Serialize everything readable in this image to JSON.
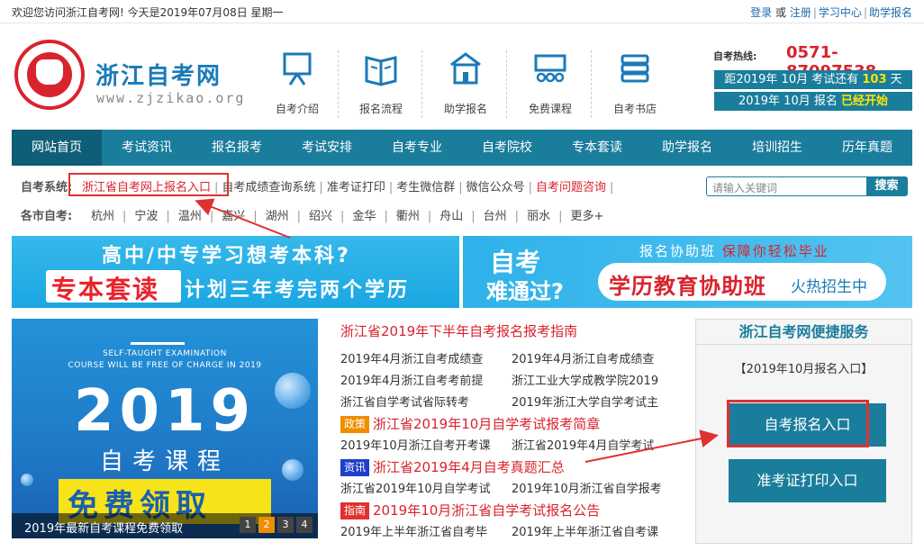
{
  "topbar": {
    "welcome": "欢迎您访问浙江自考网! 今天是2019年07月08日 星期一",
    "login": "登录",
    "or": "或",
    "register": "注册",
    "study_center": "学习中心",
    "assist_signup": "助学报名"
  },
  "header": {
    "site_name": "浙江自考网",
    "site_url": "www.zjzikao.org",
    "nav_icons": [
      {
        "label": "自考介绍",
        "icon": "presentation-board-icon"
      },
      {
        "label": "报名流程",
        "icon": "open-book-icon"
      },
      {
        "label": "助学报名",
        "icon": "school-building-icon"
      },
      {
        "label": "免费课程",
        "icon": "classroom-icon"
      },
      {
        "label": "自考书店",
        "icon": "book-stack-icon"
      }
    ],
    "hotline_label": "自考热线:",
    "hotline_number": "0571-87097538",
    "countdown_prefix": "距2019年 10月 考试还有",
    "countdown_days": "103",
    "countdown_suffix": "天",
    "signup_prefix": "2019年 10月 报名",
    "signup_status": "已经开始"
  },
  "main_nav": [
    "网站首页",
    "考试资讯",
    "报名报考",
    "考试安排",
    "自考专业",
    "自考院校",
    "专本套读",
    "助学报名",
    "培训招生",
    "历年真题"
  ],
  "system_row": {
    "label": "自考系统:",
    "links": [
      {
        "text": "浙江省自考网上报名入口",
        "red": true
      },
      {
        "text": "自考成绩查询系统",
        "red": false
      },
      {
        "text": "准考证打印",
        "red": false
      },
      {
        "text": "考生微信群",
        "red": false
      },
      {
        "text": "微信公众号",
        "red": false
      },
      {
        "text": "自考问题咨询",
        "red": true
      }
    ]
  },
  "search": {
    "placeholder": "请输入关键词",
    "button": "搜索"
  },
  "city_row": {
    "label": "各市自考:",
    "cities": [
      "杭州",
      "宁波",
      "温州",
      "嘉兴",
      "湖州",
      "绍兴",
      "金华",
      "衢州",
      "舟山",
      "台州",
      "丽水",
      "更多+"
    ]
  },
  "banner_left": {
    "line1": "高中/中专学习想考本科?",
    "highlight": "专本套读",
    "rest": "计划三年考完两个学历"
  },
  "banner_right": {
    "left_line1": "自考",
    "left_line2": "难通过?",
    "top_prefix": "报名协助班",
    "top_highlight": "保障你轻松毕业",
    "main": "学历教育协助班",
    "sub": "火热招生中"
  },
  "promo": {
    "en_line1": "SELF-TAUGHT EXAMINATION",
    "en_line2": "COURSE WILL BE FREE OF CHARGE IN 2019",
    "year": "2019",
    "course": "自考课程",
    "free": "免费领取",
    "caption": "2019年最新自考课程免费领取",
    "pages": [
      "1",
      "2",
      "3",
      "4"
    ],
    "active_page": "2"
  },
  "news": {
    "headline1": "浙江省2019年下半年自考报名报考指南",
    "rows1": [
      [
        "2019年4月浙江自考成绩查",
        "2019年4月浙江自考成绩查"
      ],
      [
        "2019年4月浙江自考考前提",
        "浙江工业大学成教学院2019"
      ],
      [
        "浙江省自学考试省际转考",
        "2019年浙江大学自学考试主"
      ]
    ],
    "tag1": "政策",
    "headline2": "浙江省2019年10月自学考试报考简章",
    "rows2": [
      [
        "2019年10月浙江自考开考课",
        "浙江省2019年4月自学考试"
      ]
    ],
    "tag2": "资讯",
    "headline3": "浙江省2019年4月自考真题汇总",
    "rows3": [
      [
        "浙江省2019年10月自学考试",
        "2019年10月浙江省自学报考"
      ]
    ],
    "tag3": "指南",
    "headline4": "2019年10月浙江省自学考试报名公告",
    "rows4": [
      [
        "2019年上半年浙江省自考毕",
        "2019年上半年浙江省自考课"
      ]
    ]
  },
  "service": {
    "title": "浙江自考网便捷服务",
    "subtitle": "【2019年10月报名入口】",
    "signup_button": "自考报名入口",
    "ticket_button": "准考证打印入口"
  },
  "colors": {
    "brand": "#1a7d9c",
    "accent_red": "#d9232d",
    "highlight_yellow": "#ffe400"
  }
}
